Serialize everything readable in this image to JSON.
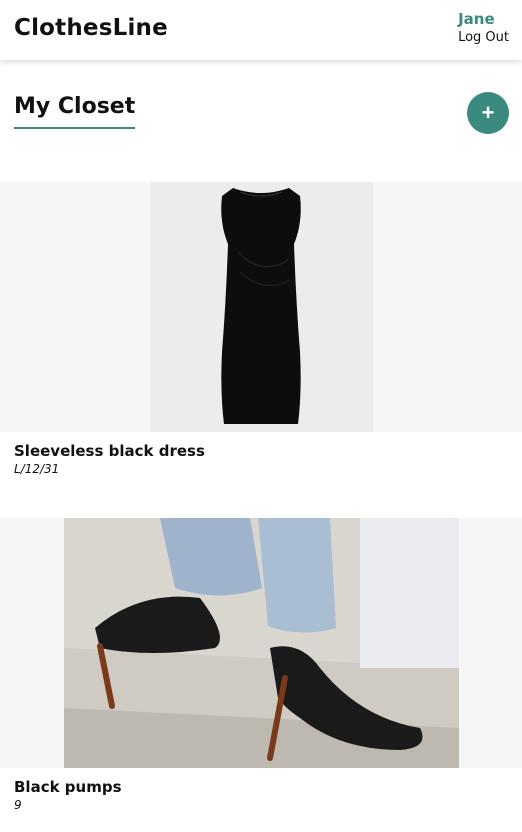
{
  "app": {
    "title": "ClothesLine"
  },
  "user": {
    "name": "Jane",
    "logout_label": "Log Out"
  },
  "page": {
    "title": "My Closet",
    "add_label": "+"
  },
  "items": [
    {
      "name": "Sleeveless black dress",
      "size": "L/12/31"
    },
    {
      "name": "Black pumps",
      "size": "9"
    }
  ],
  "colors": {
    "accent": "#3a8a80",
    "text": "#111111",
    "image_bg": "#f6f6f4"
  },
  "icons": {
    "add": "plus-icon"
  }
}
